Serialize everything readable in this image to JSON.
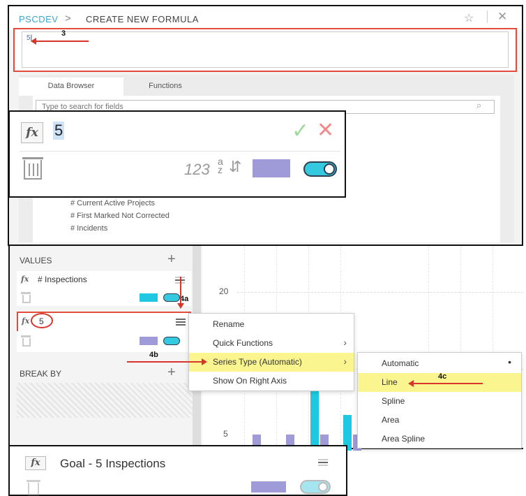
{
  "header": {
    "app_name": "PSCDEV",
    "separator": ">",
    "title": "CREATE NEW FORMULA",
    "star_icon": "star-icon",
    "close_icon": "close-icon"
  },
  "formula": {
    "value": "5"
  },
  "steps": {
    "s3": "3",
    "s4a": "4a",
    "s4b": "4b",
    "s4c": "4c"
  },
  "tabs": [
    {
      "label": "Data Browser"
    },
    {
      "label": "Functions"
    }
  ],
  "search": {
    "placeholder": "Type to search for fields"
  },
  "fields": [
    "# Current Active Projects",
    "# First Marked Not Corrected",
    "# Incidents"
  ],
  "editor_overlay": {
    "fx": "fx",
    "value": "5",
    "type_label": "123",
    "sort_label": "a z",
    "color": "#9f9ad8"
  },
  "values_panel": {
    "values_label": "VALUES",
    "items": [
      {
        "fx": "fx",
        "name": "# Inspections",
        "color": "#1fc8e0"
      },
      {
        "fx": "fx",
        "name": "5",
        "color": "#9f9ad8"
      }
    ],
    "break_by_label": "BREAK BY"
  },
  "chart": {
    "y_labels": [
      "20",
      "5"
    ]
  },
  "context_menu": {
    "items": [
      "Rename",
      "Quick Functions",
      "Series Type (Automatic)",
      "Show On Right Axis"
    ]
  },
  "submenu": {
    "items": [
      "Automatic",
      "Line",
      "Spline",
      "Area",
      "Area Spline"
    ],
    "selected_marker": "•"
  },
  "bottom_card": {
    "fx": "fx",
    "name": "Goal - 5 Inspections"
  },
  "colors": {
    "accent": "#1fc8e0",
    "purple": "#9f9ad8",
    "highlight": "#fbf590",
    "annotation": "#d9362b"
  }
}
